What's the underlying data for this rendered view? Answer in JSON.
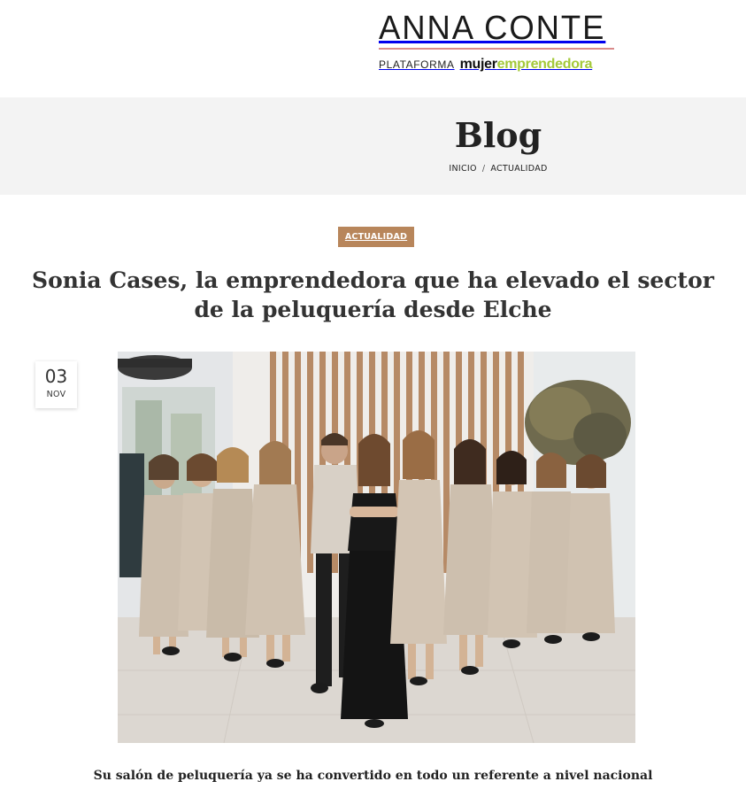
{
  "logo": {
    "name": "ANNA CONTE",
    "platform": "PLATAFORMA",
    "brand_part1": "mujer",
    "brand_part2": "emprendedora"
  },
  "banner": {
    "title": "Blog",
    "breadcrumb": [
      "INICIO",
      "ACTUALIDAD"
    ],
    "separator": "/"
  },
  "article": {
    "category": "ACTUALIDAD",
    "title": "Sonia Cases, la emprendedora que ha elevado el sector de la peluquería desde Elche",
    "date_day": "03",
    "date_month": "NOV",
    "subtitle": "Su salón de peluquería ya se ha convertido en todo un referente a nivel nacional"
  },
  "colors": {
    "badge": "#b8865b",
    "banner_bg": "#f3f3f3",
    "logo_rule": "#d98a8a",
    "brand_green": "#a4c93a"
  }
}
